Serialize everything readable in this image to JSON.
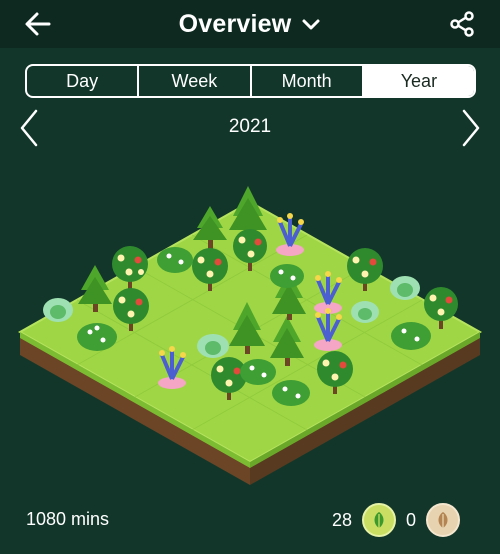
{
  "header": {
    "title": "Overview",
    "back_icon": "arrow-left-icon",
    "dropdown_icon": "chevron-down-icon",
    "share_icon": "share-icon"
  },
  "tabs": [
    {
      "label": "Day",
      "active": false
    },
    {
      "label": "Week",
      "active": false
    },
    {
      "label": "Month",
      "active": false
    },
    {
      "label": "Year",
      "active": true
    }
  ],
  "period": {
    "label": "2021",
    "prev_icon": "chevron-left-icon",
    "next_icon": "chevron-right-icon"
  },
  "summary": {
    "minutes": "1080 mins",
    "healthy_count": "28",
    "withered_count": "0",
    "healthy_icon": "leaf-icon",
    "withered_icon": "dead-leaf-icon"
  },
  "colors": {
    "background": "#12372a",
    "topbar": "#0e2a20",
    "grass": "#9fd645",
    "soil": "#6b4526"
  }
}
